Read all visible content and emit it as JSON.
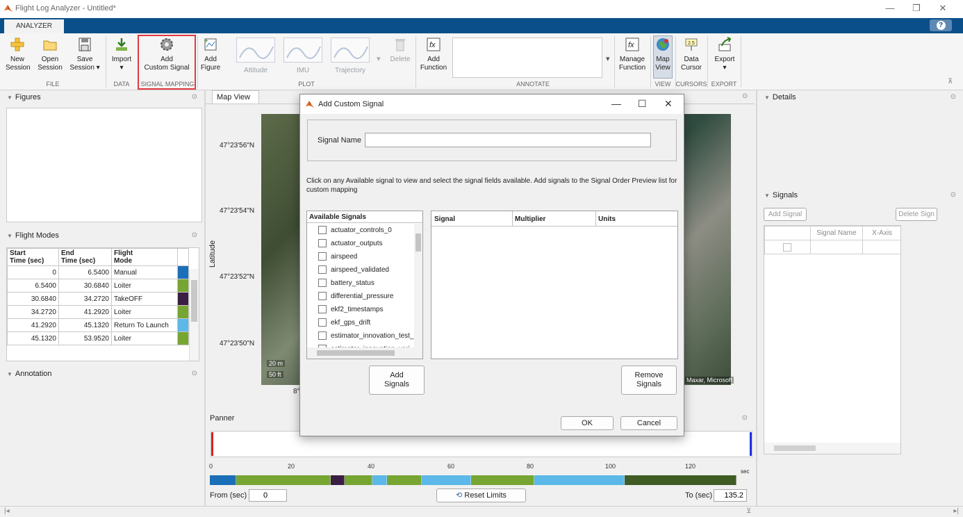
{
  "window": {
    "title": "Flight Log Analyzer - Untitled*",
    "minimize": "—",
    "restore": "❐",
    "close": "✕"
  },
  "tabs": {
    "analyzer": "ANALYZER",
    "help": "?"
  },
  "toolstrip": {
    "new_session": [
      "New",
      "Session"
    ],
    "open_session": [
      "Open",
      "Session"
    ],
    "save_session": [
      "Save",
      "Session ▾"
    ],
    "import": [
      "Import",
      "▾"
    ],
    "add_custom_signal": [
      "Add",
      "Custom Signal"
    ],
    "add_figure": [
      "Add",
      "Figure"
    ],
    "attitude": "Attitude",
    "imu": "IMU",
    "trajectory": "Trajectory",
    "delete": "Delete",
    "add_function": [
      "Add",
      "Function"
    ],
    "manage_function": [
      "Manage",
      "Function"
    ],
    "map_view": [
      "Map",
      "View"
    ],
    "data_cursor": [
      "Data",
      "Cursor"
    ],
    "export": [
      "Export",
      "▾"
    ],
    "groups": {
      "file": "FILE",
      "data": "DATA",
      "signal_mapping": "SIGNAL MAPPING",
      "plot": "PLOT",
      "annotate": "ANNOTATE",
      "view": "VIEW",
      "cursors": "CURSORS",
      "export": "EXPORT"
    }
  },
  "left": {
    "figures": "Figures",
    "flight_modes": "Flight Modes",
    "annotation": "Annotation",
    "table_headers": [
      [
        "Start",
        "Time (sec)"
      ],
      [
        "End",
        "Time (sec)"
      ],
      [
        "Flight",
        "Mode"
      ]
    ],
    "rows": [
      [
        "0",
        "6.5400",
        "Manual"
      ],
      [
        "6.5400",
        "30.6840",
        "Loiter"
      ],
      [
        "30.6840",
        "34.2720",
        "TakeOFF"
      ],
      [
        "34.2720",
        "41.2920",
        "Loiter"
      ],
      [
        "41.2920",
        "45.1320",
        "Return To Launch"
      ],
      [
        "45.1320",
        "53.9520",
        "Loiter"
      ]
    ],
    "row_colors": [
      "#1a6fb8",
      "#77a532",
      "#3b1e44",
      "#77a532",
      "#5bb8e8",
      "#77a532"
    ]
  },
  "map": {
    "tab": "Map View",
    "ylabel": "Latitude",
    "lat_ticks": [
      "47°23'56\"N",
      "47°23'54\"N",
      "47°23'52\"N",
      "47°23'50\"N"
    ],
    "scale_m": "20 m",
    "scale_ft": "50 ft",
    "attribution": "Maxar, Microsoft",
    "lon_fragment": "8°"
  },
  "panner": {
    "title": "Panner",
    "ticks": [
      "0",
      "20",
      "40",
      "60",
      "80",
      "100",
      "120"
    ],
    "unit": "sec",
    "from_label": "From (sec)",
    "from_value": "0",
    "to_label": "To (sec)",
    "to_value": "135.2",
    "reset": "Reset Limits",
    "segments": [
      {
        "w": 38,
        "c": "#1a6fb8"
      },
      {
        "w": 136,
        "c": "#77a532"
      },
      {
        "w": 20,
        "c": "#3b1e44"
      },
      {
        "w": 40,
        "c": "#77a532"
      },
      {
        "w": 21,
        "c": "#5bb8e8"
      },
      {
        "w": 50,
        "c": "#77a532"
      },
      {
        "w": 71,
        "c": "#5bb8e8"
      },
      {
        "w": 91,
        "c": "#77a532"
      },
      {
        "w": 130,
        "c": "#5bb8e8"
      },
      {
        "w": 161,
        "c": "#3f5c24"
      }
    ]
  },
  "right": {
    "details": "Details",
    "signals": "Signals",
    "add_signal": "Add Signal",
    "delete_signal": "Delete Sign",
    "col_signal_name": "Signal Name",
    "col_x_axis": "X-Axis"
  },
  "dialog": {
    "title": "Add Custom Signal",
    "signal_name_label": "Signal Name",
    "signal_name_value": "",
    "instructions": "Click on any Available signal to view and select the signal fields available. Add signals to the Signal Order Preview list for custom mapping",
    "available_header": "Available Signals",
    "signals": [
      "actuator_controls_0",
      "actuator_outputs",
      "airspeed",
      "airspeed_validated",
      "battery_status",
      "differential_pressure",
      "ekf2_timestamps",
      "ekf_gps_drift",
      "estimator_innovation_test_",
      "estimator_innovation_vari"
    ],
    "cols": [
      "Signal",
      "Multiplier",
      "Units"
    ],
    "add_signals": [
      "Add",
      "Signals"
    ],
    "remove_signals": [
      "Remove",
      "Signals"
    ],
    "ok": "OK",
    "cancel": "Cancel"
  }
}
